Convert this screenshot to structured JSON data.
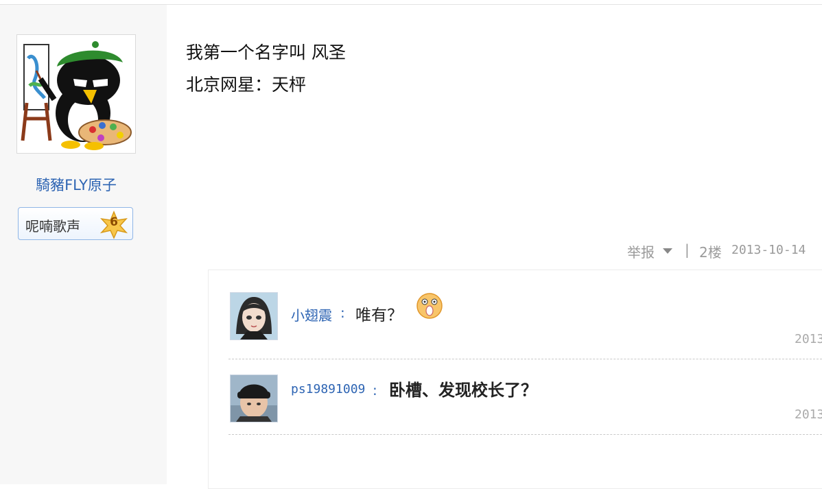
{
  "author": {
    "username": "騎豬FLY原子",
    "badge_label": "呢喃歌声",
    "badge_level": "6"
  },
  "post": {
    "lines": [
      "我第一个名字叫 风圣",
      "北京网星：天枰"
    ]
  },
  "meta": {
    "report": "举报",
    "separator": "|",
    "floor": "2楼",
    "date": "2013-10-14"
  },
  "replies": [
    {
      "user": "小翅震",
      "text": "唯有？",
      "date": "2013"
    },
    {
      "user": "ps19891009",
      "text": "卧槽、发现校长了？",
      "date": "2013"
    }
  ],
  "colors": {
    "link": "#2d64b3",
    "sidebar_bg": "#f7f7f7",
    "badge_border": "#8fb5e6",
    "meta_gray": "#9a9a9a"
  }
}
